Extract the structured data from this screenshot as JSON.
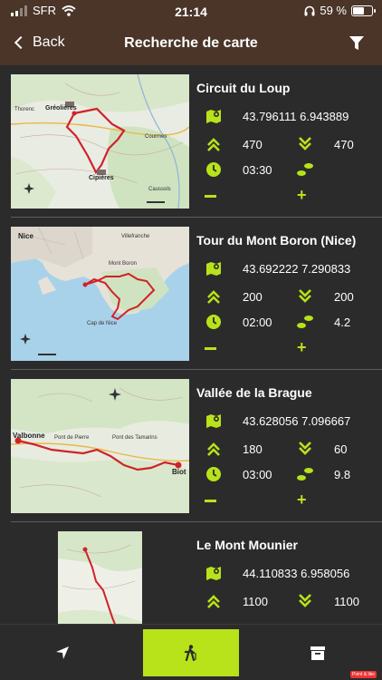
{
  "status": {
    "carrier": "SFR",
    "time": "21:14",
    "battery": "59 %",
    "battery_level": 0.59
  },
  "header": {
    "back_label": "Back",
    "title": "Recherche de carte"
  },
  "colors": {
    "accent": "#b8e21a",
    "header_bg": "#4a3528",
    "background": "#2b2b2b",
    "route": "#d0222a"
  },
  "hikes": [
    {
      "name": "Circuit du Loup",
      "coordinates": "43.796111 6.943889",
      "ascent": "470",
      "descent": "470",
      "duration": "03:30",
      "distance": ""
    },
    {
      "name": "Tour du Mont Boron (Nice)",
      "coordinates": "43.692222 7.290833",
      "ascent": "200",
      "descent": "200",
      "duration": "02:00",
      "distance": "4.2"
    },
    {
      "name": "Vallée de la Brague",
      "coordinates": "43.628056 7.096667",
      "ascent": "180",
      "descent": "60",
      "duration": "03:00",
      "distance": "9.8"
    },
    {
      "name": "Le Mont Mounier",
      "coordinates": "44.110833 6.958056",
      "ascent": "1100",
      "descent": "1100",
      "duration": "",
      "distance": ""
    }
  ],
  "maps": {
    "loup": [
      "Thorenc",
      "Gréolières",
      "Cipières",
      "Courmes",
      "Caussols"
    ],
    "boron": [
      "Nice",
      "Villefranche",
      "Mont Boron",
      "Cap de Nice"
    ],
    "brague": [
      "Valbonne",
      "Pont de Pierre",
      "Pont des Tamarins",
      "Biot"
    ]
  },
  "tabs": {
    "nearby": "location-arrow-icon",
    "hikes": "hiker-icon",
    "archive": "archive-icon",
    "corner_badge": "Point & like"
  }
}
